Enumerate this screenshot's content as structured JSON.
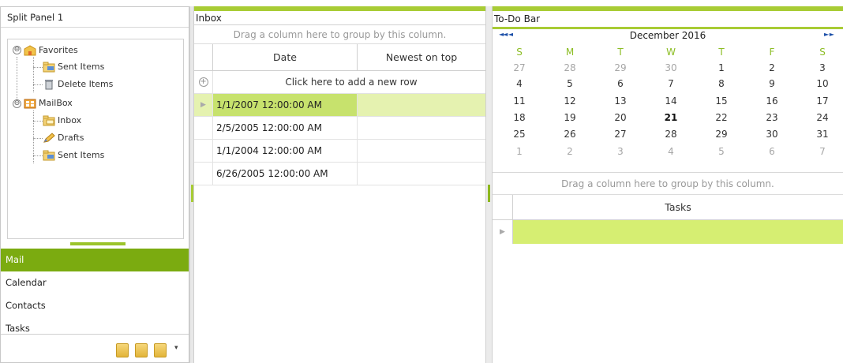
{
  "left_panel": {
    "title": "Split Panel 1",
    "tree": [
      {
        "label": "Favorites",
        "icon": "favorites-folder-icon",
        "expanded": true
      },
      {
        "label": "Sent Items",
        "icon": "folder-icon"
      },
      {
        "label": "Delete Items",
        "icon": "trash-icon"
      },
      {
        "label": "MailBox",
        "icon": "mailbox-icon",
        "expanded": true
      },
      {
        "label": "Inbox",
        "icon": "folder-icon"
      },
      {
        "label": "Drafts",
        "icon": "pencil-icon"
      },
      {
        "label": "Sent Items",
        "icon": "folder-icon"
      }
    ],
    "toggle_glyph": "⊖"
  },
  "navbar": {
    "items": [
      {
        "label": "Mail",
        "active": true
      },
      {
        "label": "Calendar",
        "active": false
      },
      {
        "label": "Contacts",
        "active": false
      },
      {
        "label": "Tasks",
        "active": false
      }
    ],
    "overflow_arrow": "▾"
  },
  "inbox": {
    "caption": "Inbox",
    "group_hint": "Drag a column here to group by this column.",
    "columns": [
      "Date",
      "Newest on top"
    ],
    "add_row_label": "Click here to add a new row",
    "add_row_glyph": "+",
    "row_indicator": "▶",
    "rows": [
      {
        "date": "1/1/2007 12:00:00 AM",
        "sort": "",
        "selected": true
      },
      {
        "date": "2/5/2005 12:00:00 AM",
        "sort": ""
      },
      {
        "date": "1/1/2004 12:00:00 AM",
        "sort": ""
      },
      {
        "date": "6/26/2005 12:00:00 AM",
        "sort": ""
      }
    ]
  },
  "todo": {
    "caption": "To-Do Bar",
    "calendar": {
      "nav_prev": "◄◄ ◄",
      "nav_next": "► ►",
      "month_title": "December 2016",
      "days_of_week": [
        "S",
        "M",
        "T",
        "W",
        "T",
        "F",
        "S"
      ],
      "weeks": [
        [
          "27",
          "28",
          "29",
          "30",
          "1",
          "2",
          "3"
        ],
        [
          "4",
          "5",
          "6",
          "7",
          "8",
          "9",
          "10"
        ],
        [
          "11",
          "12",
          "13",
          "14",
          "15",
          "16",
          "17"
        ],
        [
          "18",
          "19",
          "20",
          "21",
          "22",
          "23",
          "24"
        ],
        [
          "25",
          "26",
          "27",
          "28",
          "29",
          "30",
          "31"
        ],
        [
          "1",
          "2",
          "3",
          "4",
          "5",
          "6",
          "7"
        ]
      ],
      "today": "21"
    },
    "group_hint": "Drag a column here to group by this column.",
    "tasks_column": "Tasks",
    "row_indicator": "▶"
  },
  "colors": {
    "accent": "#a8cc35",
    "active_nav": "#7bab10",
    "selection": "#d6ee72"
  }
}
